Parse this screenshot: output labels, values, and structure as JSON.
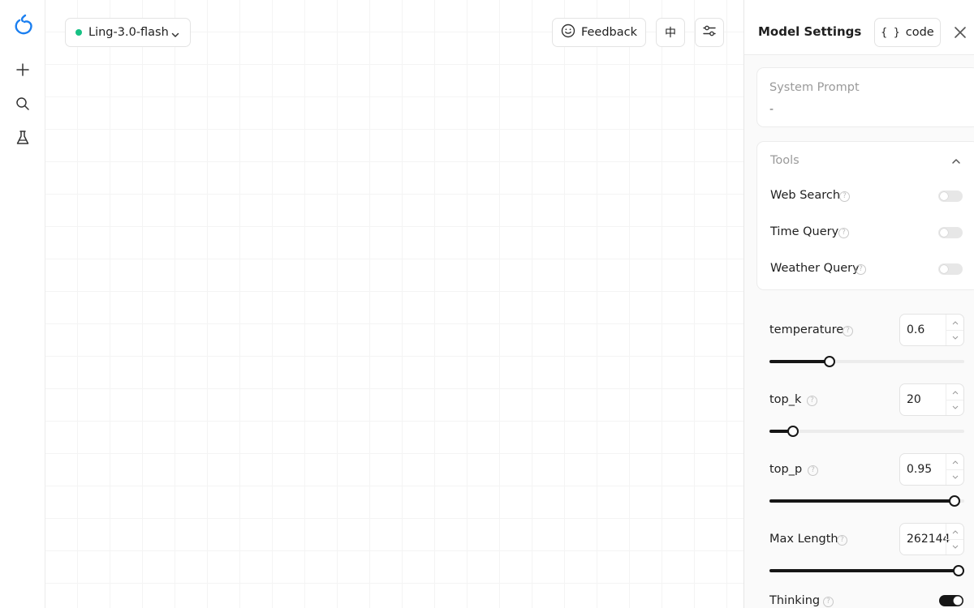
{
  "model": {
    "name": "Ling-3.0-flash",
    "status_color": "#16c184"
  },
  "header": {
    "feedback_label": "Feedback",
    "lang_label": "中"
  },
  "sidebar": {
    "items": [
      {
        "name": "logo-icon"
      },
      {
        "name": "new-chat-icon"
      },
      {
        "name": "search-icon"
      },
      {
        "name": "flask-icon"
      }
    ]
  },
  "panel": {
    "title": "Model Settings",
    "code_label": "code",
    "system_prompt": {
      "label": "System Prompt",
      "value": "-"
    },
    "tools": {
      "label": "Tools",
      "items": [
        {
          "label": "Web Search",
          "enabled": false
        },
        {
          "label": "Time Query",
          "enabled": false
        },
        {
          "label": "Weather Query",
          "enabled": false
        }
      ]
    },
    "params": [
      {
        "label": "temperature",
        "value": "0.6",
        "fraction": 0.31
      },
      {
        "label": "top_k",
        "value": "20",
        "fraction": 0.12
      },
      {
        "label": "top_p",
        "value": "0.95",
        "fraction": 0.95
      },
      {
        "label": "Max Length",
        "value": "262144",
        "fraction": 1.0
      }
    ],
    "thinking": {
      "label": "Thinking",
      "enabled": true
    }
  },
  "colors": {
    "accent": "#161616",
    "status": "#16c184",
    "logo": "#1b7ff0"
  }
}
